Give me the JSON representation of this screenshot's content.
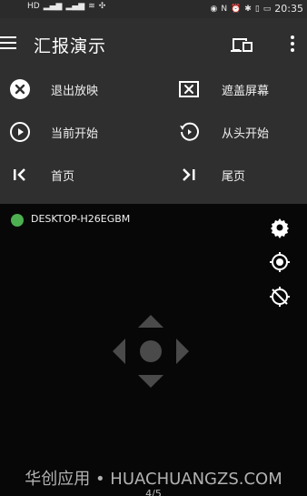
{
  "status_bar": {
    "left_indicators": [
      "HD",
      "4G",
      "4G",
      "wifi",
      "usb"
    ],
    "right_indicators": [
      "eye",
      "nfc",
      "alarm",
      "bluetooth",
      "vibrate",
      "battery"
    ],
    "time": "20:35"
  },
  "app_bar": {
    "title": "汇报演示",
    "menu_icon": "menu-icon",
    "cast_icon": "cast-icon",
    "more_icon": "more-vert-icon"
  },
  "controls": [
    {
      "id": "exit",
      "label": "退出放映",
      "icon": "close-circle-icon"
    },
    {
      "id": "cover",
      "label": "遮盖屏幕",
      "icon": "cover-screen-icon"
    },
    {
      "id": "current",
      "label": "当前开始",
      "icon": "play-circle-icon"
    },
    {
      "id": "restart",
      "label": "从头开始",
      "icon": "replay-icon"
    },
    {
      "id": "first",
      "label": "首页",
      "icon": "skip-first-icon"
    },
    {
      "id": "last",
      "label": "尾页",
      "icon": "skip-last-icon"
    }
  ],
  "device": {
    "name": "DESKTOP-H26EGBM",
    "status_color": "#4caf50"
  },
  "side_tools": [
    "settings-icon",
    "target-icon",
    "target-off-icon"
  ],
  "watermark": "华创应用 • HUACHUANGZS.COM",
  "page_indicator": "4/5",
  "colors": {
    "toolbar_bg": "#2f2f2f",
    "screen_bg": "#070707",
    "text": "#f0f0f0"
  }
}
